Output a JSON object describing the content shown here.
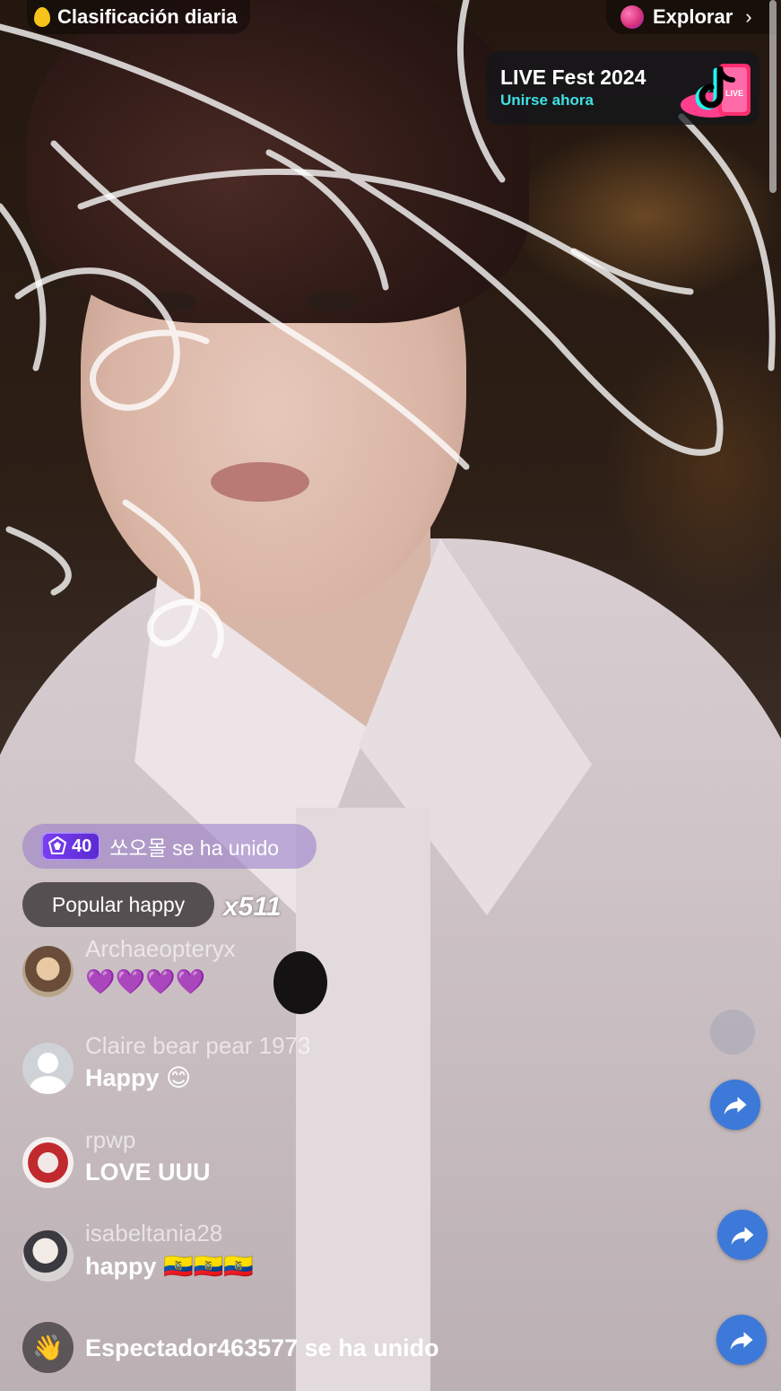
{
  "top_bar": {
    "ranking_label": "Clasificación diaria",
    "explore_label": "Explorar"
  },
  "fest_banner": {
    "title": "LIVE Fest 2024",
    "subtitle": "Unirse ahora"
  },
  "join_notice": {
    "level": "40",
    "text": "쏘오몰 se ha unido"
  },
  "popular": {
    "label": "Popular happy",
    "multiplier": "x511"
  },
  "comments": [
    {
      "username": "Archaeopteryx",
      "message": "💜💜💜💜"
    },
    {
      "username": "Claire bear pear 1973",
      "message": "Happy 😊"
    },
    {
      "username": "rpwp",
      "message": "LOVE UUU"
    },
    {
      "username": "isabeltania28",
      "message": "happy 🇪🇨🇪🇨🇪🇨"
    }
  ],
  "viewer_joined": {
    "text": "Espectador463577 se ha unido"
  },
  "colors": {
    "share_button": "#3d79d8",
    "fest_subtitle": "#3fe1e4",
    "level_badge": "#7b3ef2"
  },
  "icons": [
    "flame-icon",
    "planet-icon",
    "chevron-right-icon",
    "tiktok-live-logo",
    "gem-icon",
    "share-icon",
    "wave-hand-icon"
  ]
}
